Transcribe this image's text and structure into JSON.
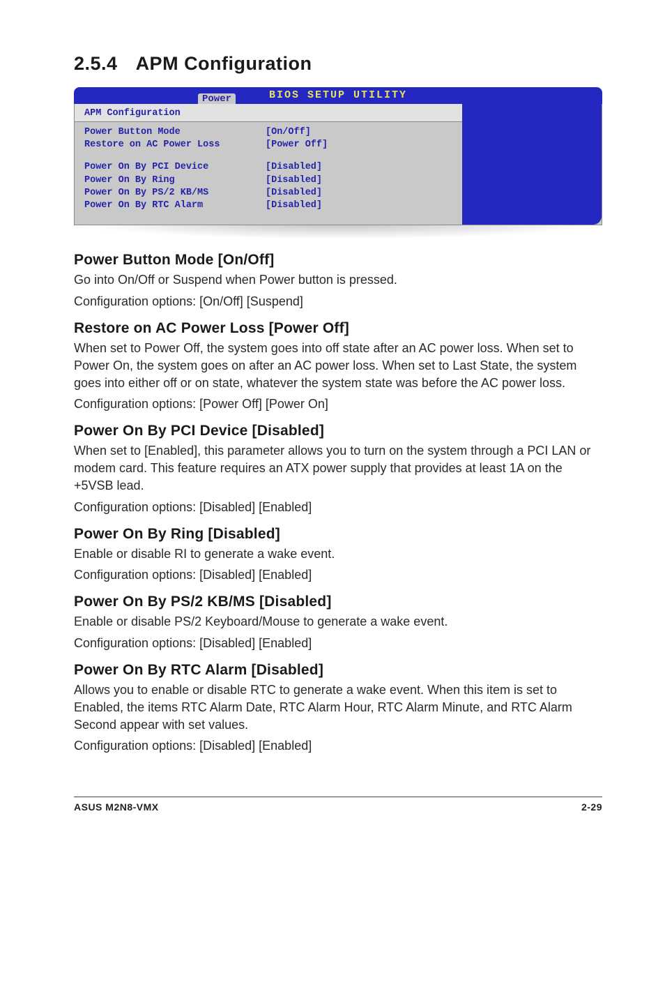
{
  "section": {
    "number": "2.5.4",
    "title": "APM Configuration"
  },
  "bios": {
    "title": "BIOS SETUP UTILITY",
    "tab": "Power",
    "section_title": "APM Configuration",
    "rows": [
      {
        "label": "Power Button Mode",
        "value": "[On/Off]"
      },
      {
        "label": "Restore on AC Power Loss",
        "value": "[Power Off]"
      }
    ],
    "rows2": [
      {
        "label": "Power On By PCI Device",
        "value": "[Disabled]"
      },
      {
        "label": "Power On By Ring",
        "value": "[Disabled]"
      },
      {
        "label": "Power On By PS/2 KB/MS",
        "value": "[Disabled]"
      },
      {
        "label": "Power On By RTC Alarm",
        "value": "[Disabled]"
      }
    ]
  },
  "items": {
    "pbm": {
      "heading": "Power Button Mode [On/Off]",
      "p1": "Go into On/Off or Suspend when Power button is pressed.",
      "p2": "Configuration options: [On/Off] [Suspend]"
    },
    "restore": {
      "heading": "Restore on AC Power Loss [Power Off]",
      "p1": "When set to Power Off, the system goes into off state after an AC power loss. When set to Power On, the system goes on after an AC power loss. When set to Last State, the system goes into either off or on state, whatever the system state was before the AC power loss.",
      "p2": "Configuration options: [Power Off] [Power On]"
    },
    "pci": {
      "heading": "Power On By PCI Device [Disabled]",
      "p1": "When set to [Enabled], this parameter allows you to turn on the system through a PCI LAN or modem card. This feature requires an ATX power supply that provides at least 1A on the +5VSB lead.",
      "p2": "Configuration options: [Disabled] [Enabled]"
    },
    "ring": {
      "heading": "Power On By Ring [Disabled]",
      "p1": "Enable or disable RI to generate a wake event.",
      "p2": "Configuration options: [Disabled] [Enabled]"
    },
    "ps2": {
      "heading": "Power On By PS/2 KB/MS [Disabled]",
      "p1": "Enable or disable PS/2 Keyboard/Mouse to generate a wake event.",
      "p2": "Configuration options: [Disabled] [Enabled]"
    },
    "rtc": {
      "heading": "Power On By RTC Alarm [Disabled]",
      "p1": "Allows you to enable or disable RTC to generate a wake event. When this item is set to Enabled, the items RTC Alarm Date, RTC Alarm Hour, RTC Alarm Minute, and RTC Alarm Second appear with set values.",
      "p2": "Configuration options: [Disabled] [Enabled]"
    }
  },
  "footer": {
    "left": "ASUS M2N8-VMX",
    "right": "2-29"
  }
}
